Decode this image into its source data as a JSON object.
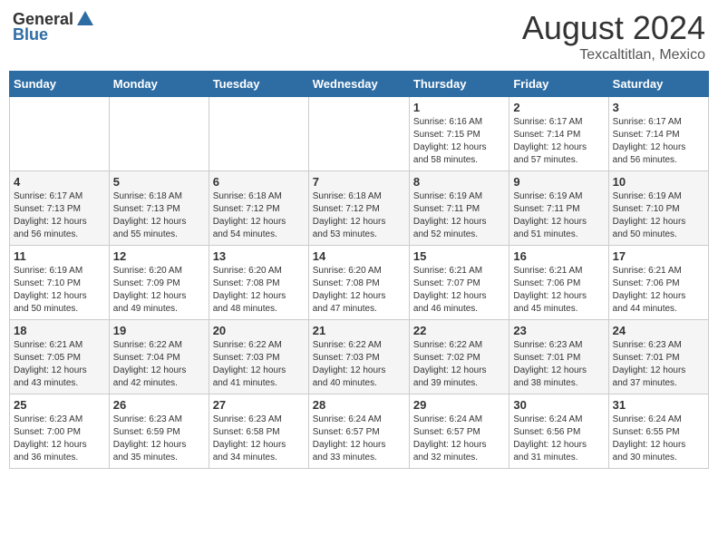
{
  "logo": {
    "general": "General",
    "blue": "Blue"
  },
  "title": {
    "month_year": "August 2024",
    "location": "Texcaltitlan, Mexico"
  },
  "weekdays": [
    "Sunday",
    "Monday",
    "Tuesday",
    "Wednesday",
    "Thursday",
    "Friday",
    "Saturday"
  ],
  "weeks": [
    [
      {
        "day": "",
        "info": ""
      },
      {
        "day": "",
        "info": ""
      },
      {
        "day": "",
        "info": ""
      },
      {
        "day": "",
        "info": ""
      },
      {
        "day": "1",
        "info": "Sunrise: 6:16 AM\nSunset: 7:15 PM\nDaylight: 12 hours\nand 58 minutes."
      },
      {
        "day": "2",
        "info": "Sunrise: 6:17 AM\nSunset: 7:14 PM\nDaylight: 12 hours\nand 57 minutes."
      },
      {
        "day": "3",
        "info": "Sunrise: 6:17 AM\nSunset: 7:14 PM\nDaylight: 12 hours\nand 56 minutes."
      }
    ],
    [
      {
        "day": "4",
        "info": "Sunrise: 6:17 AM\nSunset: 7:13 PM\nDaylight: 12 hours\nand 56 minutes."
      },
      {
        "day": "5",
        "info": "Sunrise: 6:18 AM\nSunset: 7:13 PM\nDaylight: 12 hours\nand 55 minutes."
      },
      {
        "day": "6",
        "info": "Sunrise: 6:18 AM\nSunset: 7:12 PM\nDaylight: 12 hours\nand 54 minutes."
      },
      {
        "day": "7",
        "info": "Sunrise: 6:18 AM\nSunset: 7:12 PM\nDaylight: 12 hours\nand 53 minutes."
      },
      {
        "day": "8",
        "info": "Sunrise: 6:19 AM\nSunset: 7:11 PM\nDaylight: 12 hours\nand 52 minutes."
      },
      {
        "day": "9",
        "info": "Sunrise: 6:19 AM\nSunset: 7:11 PM\nDaylight: 12 hours\nand 51 minutes."
      },
      {
        "day": "10",
        "info": "Sunrise: 6:19 AM\nSunset: 7:10 PM\nDaylight: 12 hours\nand 50 minutes."
      }
    ],
    [
      {
        "day": "11",
        "info": "Sunrise: 6:19 AM\nSunset: 7:10 PM\nDaylight: 12 hours\nand 50 minutes."
      },
      {
        "day": "12",
        "info": "Sunrise: 6:20 AM\nSunset: 7:09 PM\nDaylight: 12 hours\nand 49 minutes."
      },
      {
        "day": "13",
        "info": "Sunrise: 6:20 AM\nSunset: 7:08 PM\nDaylight: 12 hours\nand 48 minutes."
      },
      {
        "day": "14",
        "info": "Sunrise: 6:20 AM\nSunset: 7:08 PM\nDaylight: 12 hours\nand 47 minutes."
      },
      {
        "day": "15",
        "info": "Sunrise: 6:21 AM\nSunset: 7:07 PM\nDaylight: 12 hours\nand 46 minutes."
      },
      {
        "day": "16",
        "info": "Sunrise: 6:21 AM\nSunset: 7:06 PM\nDaylight: 12 hours\nand 45 minutes."
      },
      {
        "day": "17",
        "info": "Sunrise: 6:21 AM\nSunset: 7:06 PM\nDaylight: 12 hours\nand 44 minutes."
      }
    ],
    [
      {
        "day": "18",
        "info": "Sunrise: 6:21 AM\nSunset: 7:05 PM\nDaylight: 12 hours\nand 43 minutes."
      },
      {
        "day": "19",
        "info": "Sunrise: 6:22 AM\nSunset: 7:04 PM\nDaylight: 12 hours\nand 42 minutes."
      },
      {
        "day": "20",
        "info": "Sunrise: 6:22 AM\nSunset: 7:03 PM\nDaylight: 12 hours\nand 41 minutes."
      },
      {
        "day": "21",
        "info": "Sunrise: 6:22 AM\nSunset: 7:03 PM\nDaylight: 12 hours\nand 40 minutes."
      },
      {
        "day": "22",
        "info": "Sunrise: 6:22 AM\nSunset: 7:02 PM\nDaylight: 12 hours\nand 39 minutes."
      },
      {
        "day": "23",
        "info": "Sunrise: 6:23 AM\nSunset: 7:01 PM\nDaylight: 12 hours\nand 38 minutes."
      },
      {
        "day": "24",
        "info": "Sunrise: 6:23 AM\nSunset: 7:01 PM\nDaylight: 12 hours\nand 37 minutes."
      }
    ],
    [
      {
        "day": "25",
        "info": "Sunrise: 6:23 AM\nSunset: 7:00 PM\nDaylight: 12 hours\nand 36 minutes."
      },
      {
        "day": "26",
        "info": "Sunrise: 6:23 AM\nSunset: 6:59 PM\nDaylight: 12 hours\nand 35 minutes."
      },
      {
        "day": "27",
        "info": "Sunrise: 6:23 AM\nSunset: 6:58 PM\nDaylight: 12 hours\nand 34 minutes."
      },
      {
        "day": "28",
        "info": "Sunrise: 6:24 AM\nSunset: 6:57 PM\nDaylight: 12 hours\nand 33 minutes."
      },
      {
        "day": "29",
        "info": "Sunrise: 6:24 AM\nSunset: 6:57 PM\nDaylight: 12 hours\nand 32 minutes."
      },
      {
        "day": "30",
        "info": "Sunrise: 6:24 AM\nSunset: 6:56 PM\nDaylight: 12 hours\nand 31 minutes."
      },
      {
        "day": "31",
        "info": "Sunrise: 6:24 AM\nSunset: 6:55 PM\nDaylight: 12 hours\nand 30 minutes."
      }
    ]
  ]
}
